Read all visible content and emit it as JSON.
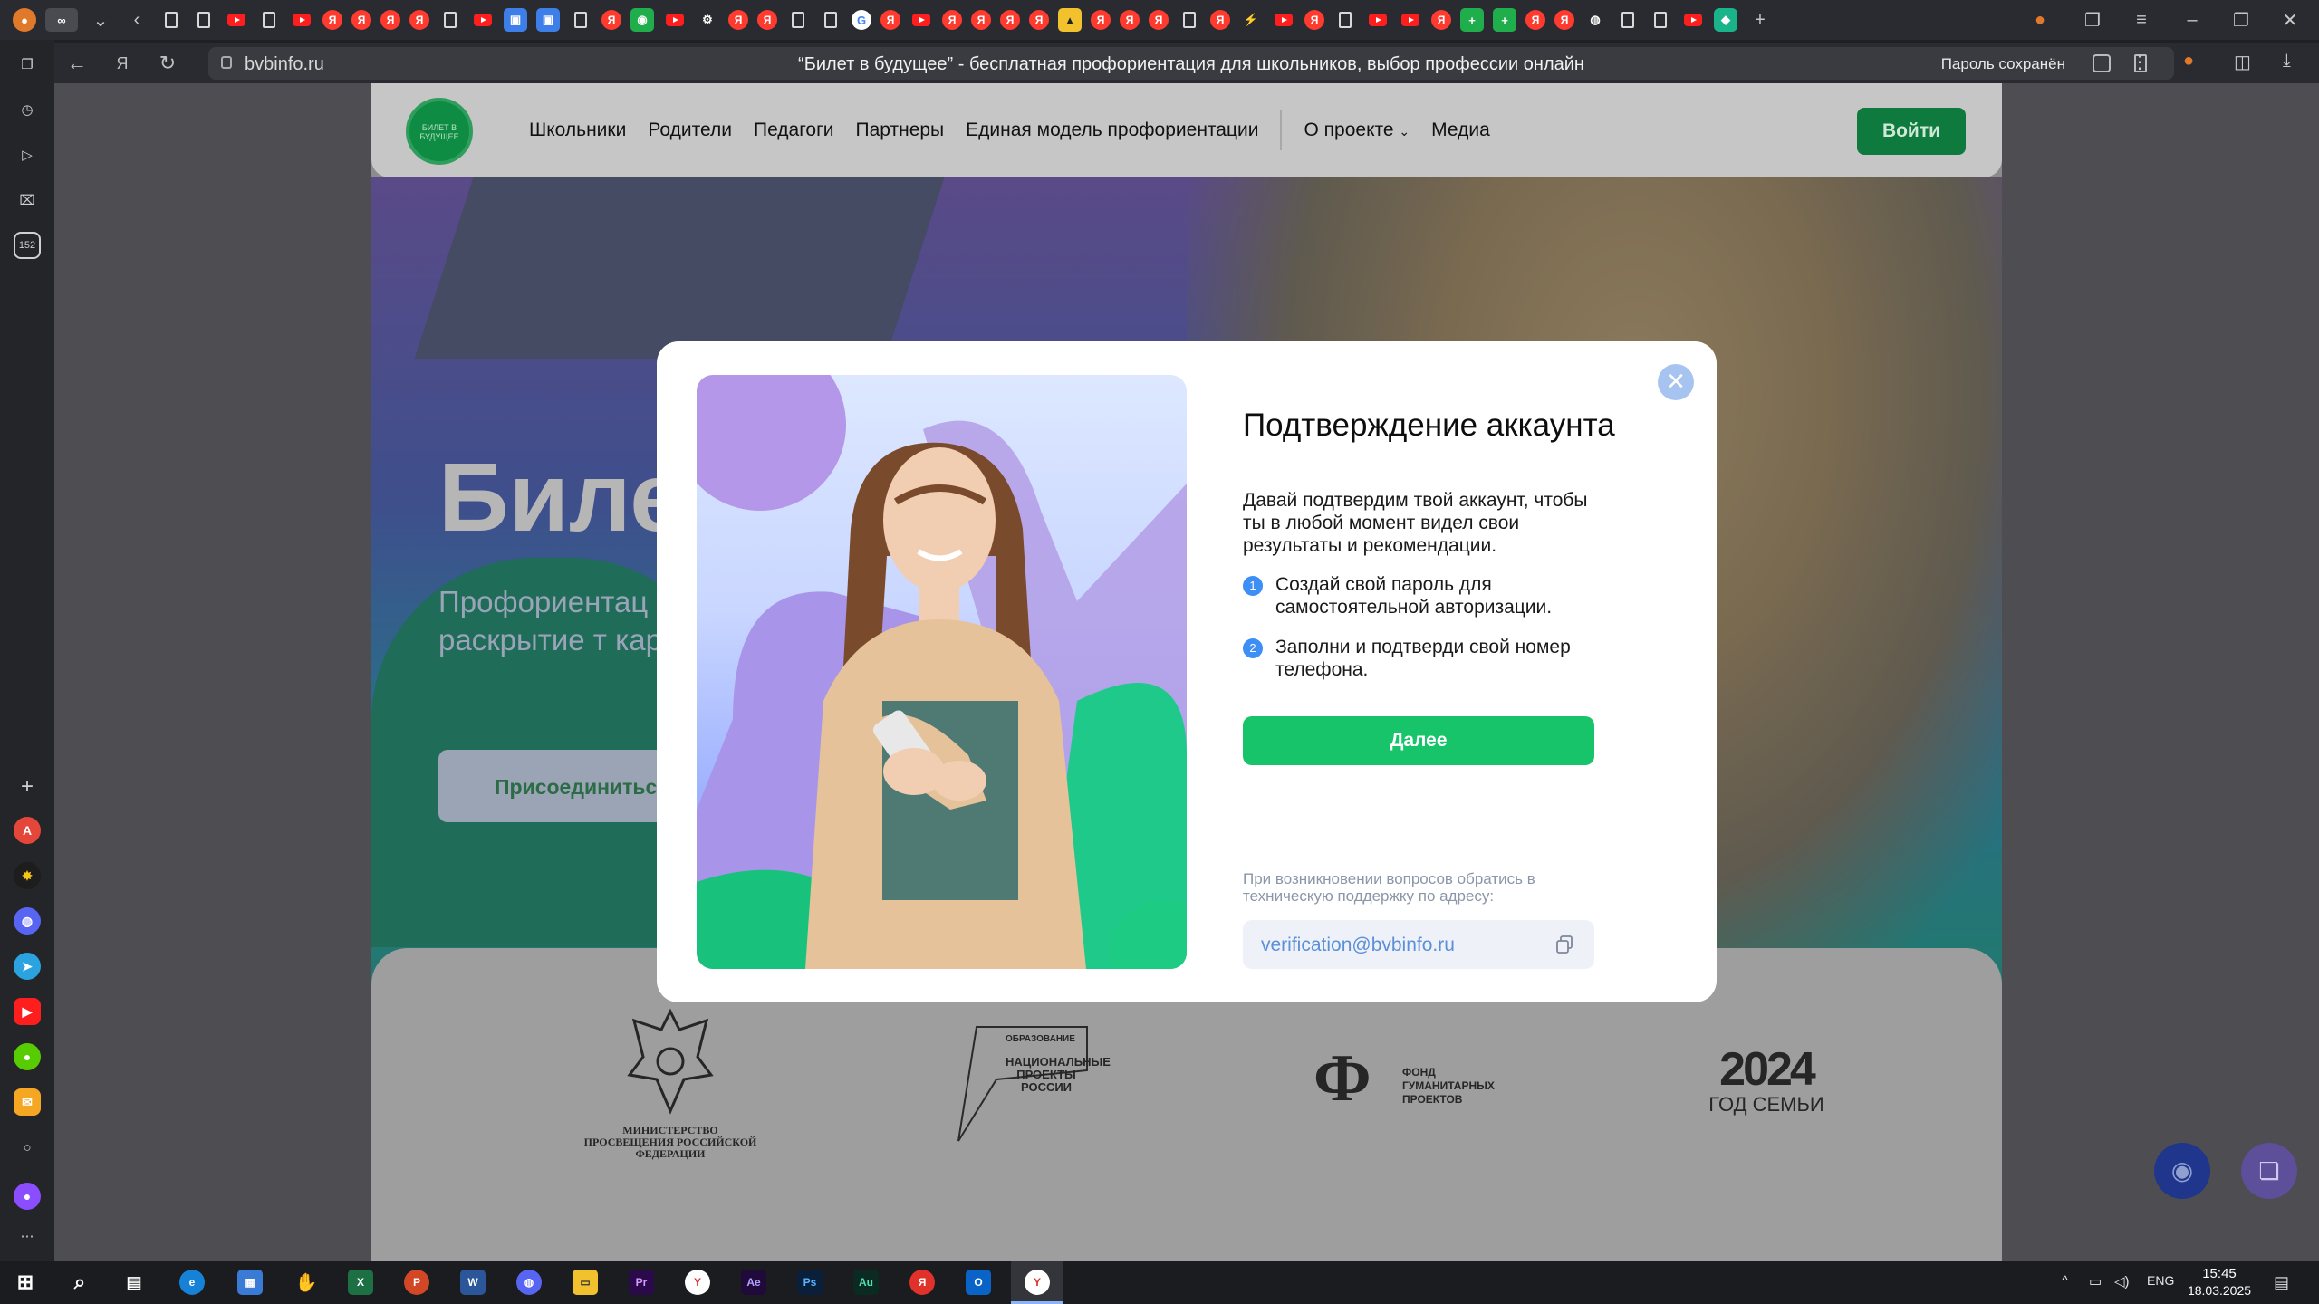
{
  "browser": {
    "url_host": "bvbinfo.ru",
    "page_title": "“Билет в будущее” - бесплатная профориентация для школьников, выбор профессии онлайн",
    "password_saved": "Пароль сохранён",
    "sidebar_badge": "152"
  },
  "site": {
    "logo_text": "БИЛЕТ В БУДУЩЕЕ",
    "nav": [
      "Школьники",
      "Родители",
      "Педагоги",
      "Партнеры",
      "Единая модель профориентации",
      "О проекте",
      "Медиа"
    ],
    "login": "Войти",
    "hero_title": "Биле",
    "hero_subtitle": "Профориентац на раскрытие т карьеры",
    "hero_button": "Присоединитьс",
    "partners": {
      "ministry": "МИНИСТЕРСТВО ПРОСВЕЩЕНИЯ РОССИЙСКОЙ ФЕДЕРАЦИИ",
      "education_top": "ОБРАЗОВАНИЕ",
      "education_main": "НАЦИОНАЛЬНЫЕ ПРОЕКТЫ РОССИИ",
      "fund": "ФОНД ГУМАНИТАРНЫХ ПРОЕКТОВ",
      "year_num": "2024",
      "year_text": "ГОД СЕМЬИ"
    }
  },
  "modal": {
    "title": "Подтверждение аккаунта",
    "description": "Давай подтвердим твой аккаунт, чтобы ты в любой момент видел свои результаты и рекомендации.",
    "steps": [
      {
        "num": "1",
        "text": "Создай свой пароль для самостоятельной авторизации."
      },
      {
        "num": "2",
        "text": "Заполни и подтверди свой номер телефона."
      }
    ],
    "next_button": "Далее",
    "help_text": "При возникновении вопросов обратись в техническую поддержку по адресу:",
    "email": "verification@bvbinfo.ru",
    "close_symbol": "✕"
  },
  "taskbar": {
    "lang": "ENG",
    "time": "15:45",
    "date": "18.03.2025"
  },
  "colors": {
    "accent_green": "#17c46a",
    "step_blue": "#3d8ef5",
    "email_blue": "#5b8fd8"
  }
}
